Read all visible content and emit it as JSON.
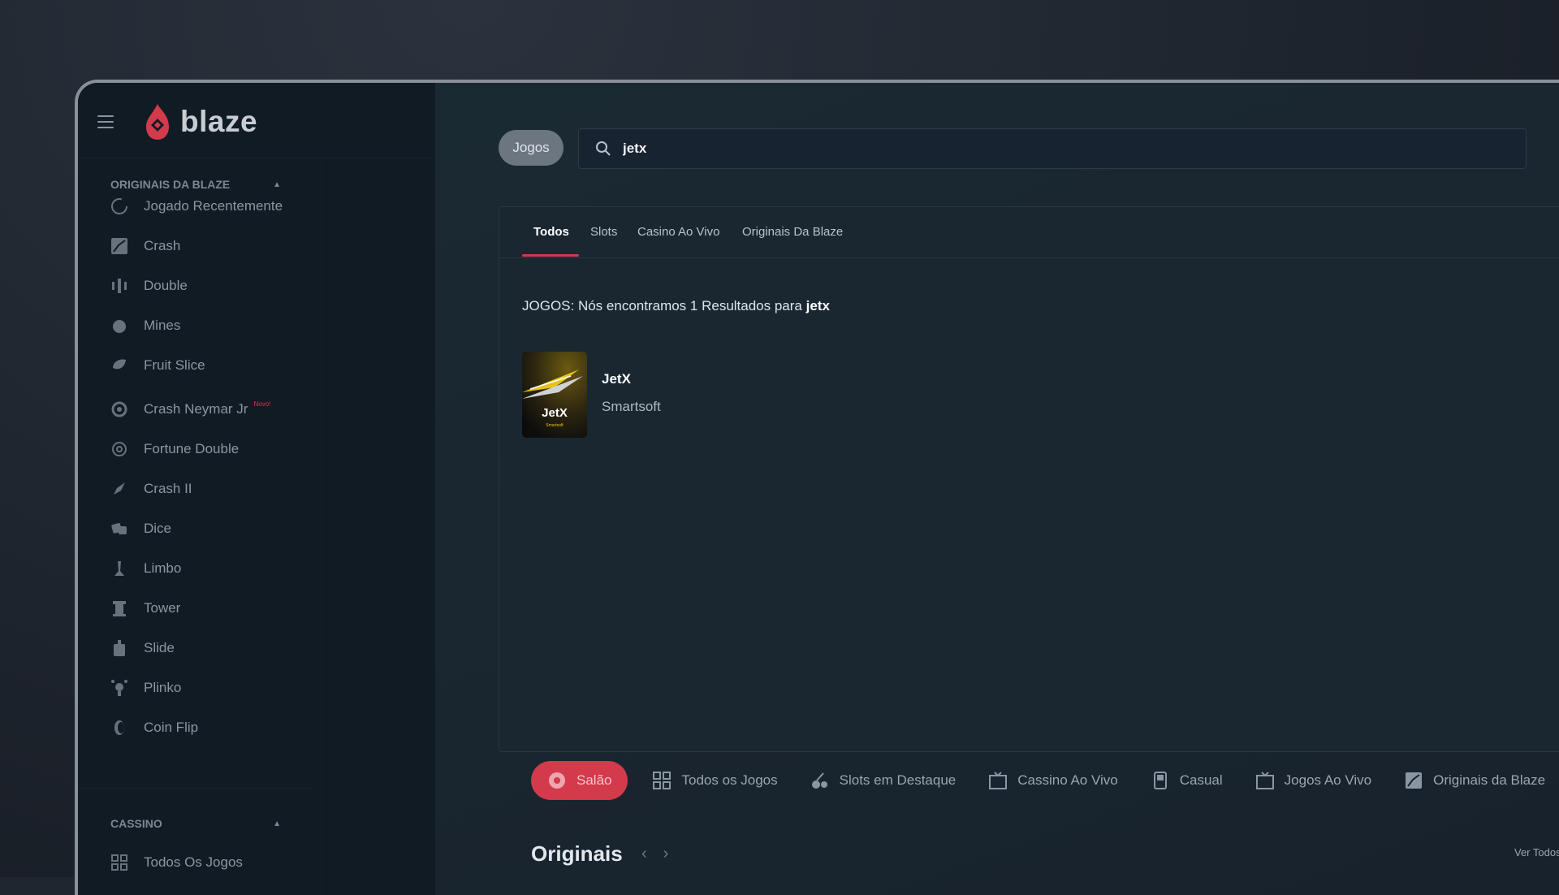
{
  "brand": {
    "name": "blaze",
    "accent": "#d33a4b"
  },
  "sidebar": {
    "section_originais": "ORIGINAIS DA BLAZE",
    "items": [
      {
        "label": "Jogado Recentemente",
        "icon": "history-icon"
      },
      {
        "label": "Crash",
        "icon": "chart-icon"
      },
      {
        "label": "Double",
        "icon": "double-icon"
      },
      {
        "label": "Mines",
        "icon": "mine-icon"
      },
      {
        "label": "Fruit Slice",
        "icon": "fruit-icon"
      },
      {
        "label": "Crash Neymar Jr",
        "icon": "ball-icon",
        "badge": "Novo!"
      },
      {
        "label": "Fortune Double",
        "icon": "fortune-icon"
      },
      {
        "label": "Crash II",
        "icon": "rocket-icon"
      },
      {
        "label": "Dice",
        "icon": "dice-icon"
      },
      {
        "label": "Limbo",
        "icon": "limbo-icon"
      },
      {
        "label": "Tower",
        "icon": "tower-icon"
      },
      {
        "label": "Slide",
        "icon": "slide-icon"
      },
      {
        "label": "Plinko",
        "icon": "plinko-icon"
      },
      {
        "label": "Coin Flip",
        "icon": "coin-icon"
      }
    ],
    "section_cassino": "CASSINO",
    "cassino_items": [
      {
        "label": "Todos Os Jogos",
        "icon": "grid-icon"
      }
    ]
  },
  "search": {
    "scope_label": "Jogos",
    "query": "jetx",
    "close_label": "✕"
  },
  "results": {
    "tabs": [
      "Todos",
      "Slots",
      "Casino Ao Vivo",
      "Originais Da Blaze"
    ],
    "summary_prefix": "JOGOS: Nós encontramos 1 Resultados para",
    "summary_query": "jetx",
    "games": [
      {
        "title": "JetX",
        "provider": "Smartsoft",
        "thumb_text": "JetX",
        "thumb_subtext": "Smartsoft"
      }
    ]
  },
  "categories": [
    {
      "label": "Salão",
      "icon": "lobby-icon",
      "active": true
    },
    {
      "label": "Todos os Jogos",
      "icon": "grid-icon"
    },
    {
      "label": "Slots em Destaque",
      "icon": "cherry-icon"
    },
    {
      "label": "Cassino Ao Vivo",
      "icon": "tv-icon"
    },
    {
      "label": "Casual",
      "icon": "gamepad-icon"
    },
    {
      "label": "Jogos Ao Vivo",
      "icon": "tv-icon"
    },
    {
      "label": "Originais da Blaze",
      "icon": "chart-icon"
    }
  ],
  "section": {
    "title": "Originais",
    "ver_todos": "Ver Todos",
    "prev": "‹",
    "next": "›"
  }
}
